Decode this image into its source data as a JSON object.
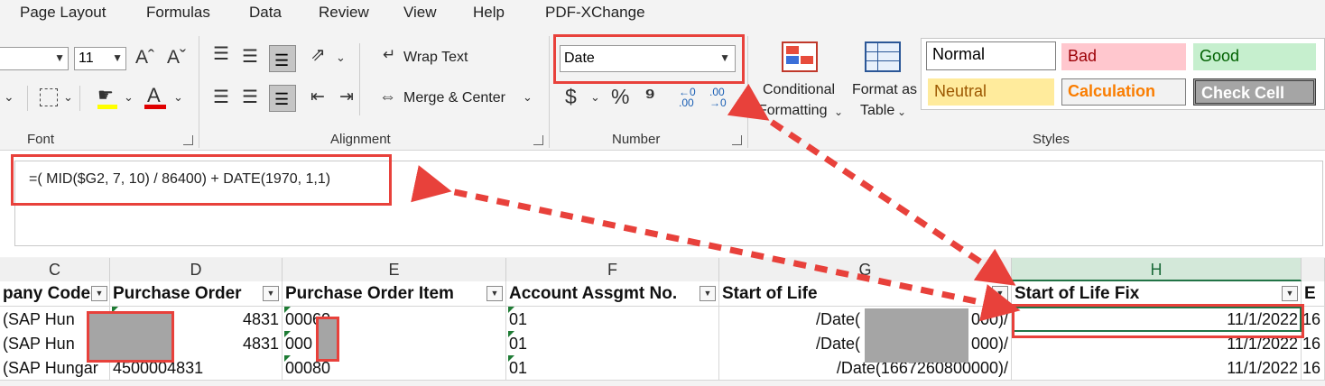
{
  "menu": {
    "items": [
      "Page Layout",
      "Formulas",
      "Data",
      "Review",
      "View",
      "Help",
      "PDF-XChange"
    ]
  },
  "ribbon": {
    "font": {
      "size_value": "11",
      "group_label": "Font",
      "grow_glyph": "Aˆ",
      "shrink_glyph": "Aˇ",
      "text_color_glyph": "A"
    },
    "alignment": {
      "wrap_text": "Wrap Text",
      "merge_center": "Merge & Center",
      "group_label": "Alignment"
    },
    "number": {
      "format_value": "Date",
      "currency_glyph": "$",
      "percent_glyph": "%",
      "comma_glyph": "⁹",
      "group_label": "Number"
    },
    "styles": {
      "conditional_line1": "Conditional",
      "conditional_line2": "Formatting",
      "format_table_line1": "Format as",
      "format_table_line2": "Table",
      "group_label": "Styles",
      "cells": [
        {
          "label": "Normal",
          "bg": "#ffffff",
          "fg": "#000000",
          "border": "#7f7f7f"
        },
        {
          "label": "Bad",
          "bg": "#ffc7ce",
          "fg": "#9c0006",
          "border": "#ffc7ce"
        },
        {
          "label": "Good",
          "bg": "#c6efce",
          "fg": "#006100",
          "border": "#c6efce"
        },
        {
          "label": "Neutral",
          "bg": "#ffeb9c",
          "fg": "#9c5700",
          "border": "#ffeb9c"
        },
        {
          "label": "Calculation",
          "bg": "#f2f2f2",
          "fg": "#fa7d00",
          "border": "#7f7f7f"
        },
        {
          "label": "Check Cell",
          "bg": "#a5a5a5",
          "fg": "#ffffff",
          "border": "#3f3f3f"
        }
      ]
    }
  },
  "formula": {
    "text": "=( MID($G2, 7, 10) / 86400)  + DATE(1970, 1,1)"
  },
  "grid": {
    "columns": [
      "C",
      "D",
      "E",
      "F",
      "G",
      "H"
    ],
    "partial_next_column": "",
    "headers": [
      "pany Code",
      "Purchase Order",
      "Purchase Order Item",
      "Account Assgmt No.",
      "Start of Life",
      "Start of Life Fix"
    ],
    "header_next_partial": "E",
    "rows": [
      {
        "c": "(SAP Hun",
        "d": "4831",
        "e": "00060",
        "f": "01",
        "g": "/Date(",
        "g2": "000)/",
        "h": "11/1/2022",
        "i": "16"
      },
      {
        "c": "(SAP Hun",
        "d": "4831",
        "e": "000",
        "f": "01",
        "g": "/Date(",
        "g2": "000)/",
        "h": "11/1/2022",
        "i": "16"
      },
      {
        "c": "(SAP Hungar",
        "d": "4500004831",
        "e": "00080",
        "f": "01",
        "g": "/Date(1667260800000)/",
        "g2": "",
        "h": "11/1/2022",
        "i": "16"
      }
    ]
  },
  "colors": {
    "highlight_red": "#e8413b",
    "excel_green": "#217346"
  }
}
